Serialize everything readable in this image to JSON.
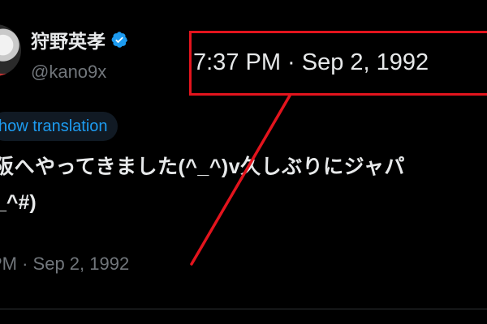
{
  "tweet": {
    "display_name": "狩野英孝",
    "handle": "@kano9x",
    "translate_label": "Show translation",
    "translate_visible": "how translation",
    "body_line1": "阪へやってきました(^_^)v久しぶりにジャパ",
    "body_line2": "_^#)",
    "timestamp": "PM · Sep 2, 1992"
  },
  "annotation": {
    "zoomed_timestamp": "7:37 PM · Sep 2, 1992",
    "color": "#e3141d"
  },
  "icons": {
    "verified": "verified-badge-icon",
    "avatar": "avatar"
  },
  "colors": {
    "background": "#000000",
    "text": "#e7e9ea",
    "muted": "#71767b",
    "link": "#1d9bf0",
    "verified": "#1d9bf0"
  }
}
